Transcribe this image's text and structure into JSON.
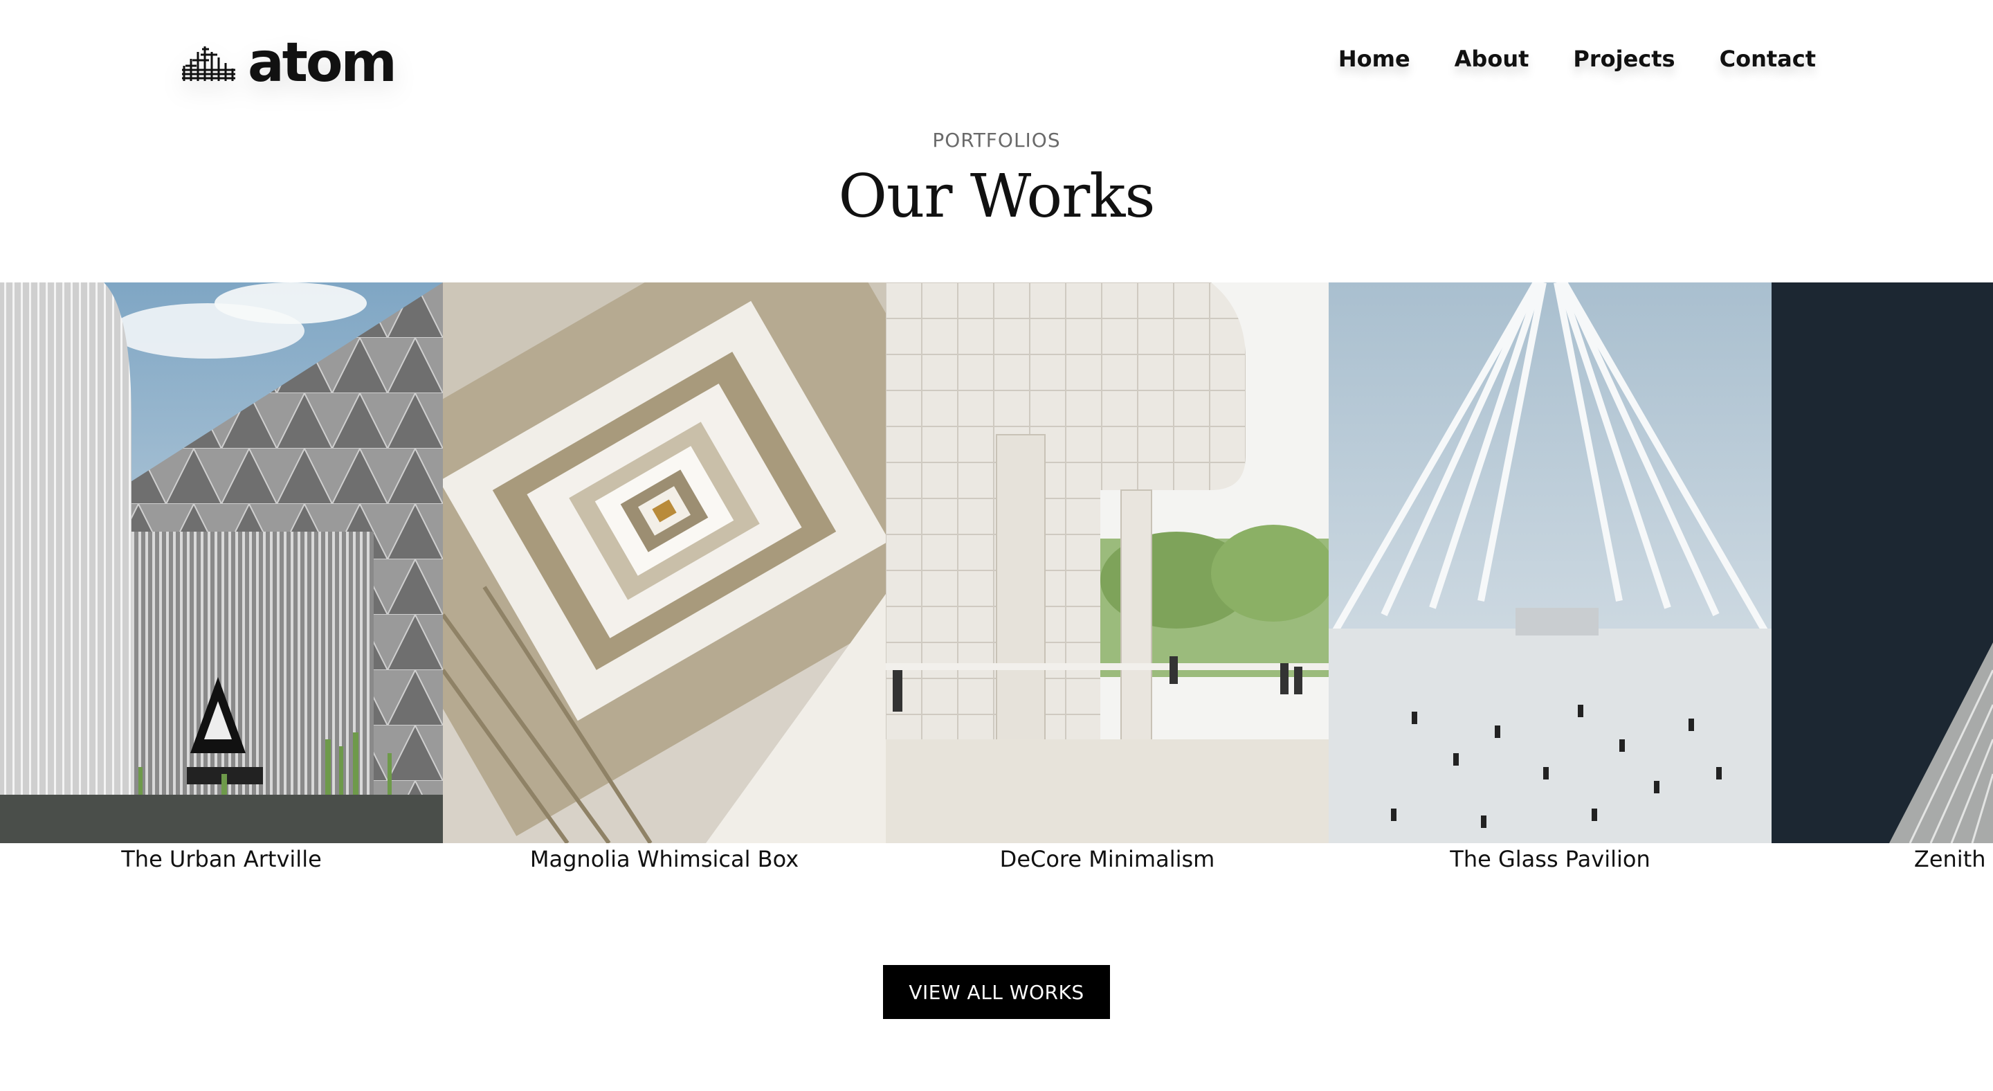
{
  "brand": {
    "name": "atom",
    "icon": "building-skyline-icon"
  },
  "nav": {
    "items": [
      "Home",
      "About",
      "Projects",
      "Contact"
    ]
  },
  "section": {
    "eyebrow": "PORTFOLIOS",
    "title": "Our Works"
  },
  "works": [
    {
      "title": "The Urban Artville"
    },
    {
      "title": "Magnolia Whimsical Box"
    },
    {
      "title": "DeCore Minimalism"
    },
    {
      "title": "The Glass Pavilion"
    },
    {
      "title": "Zenith Skyline"
    }
  ],
  "cta": {
    "label": "VIEW ALL WORKS"
  },
  "colors": {
    "text": "#111111",
    "muted": "#6a6a6a",
    "button_bg": "#000000",
    "button_text": "#ffffff"
  }
}
